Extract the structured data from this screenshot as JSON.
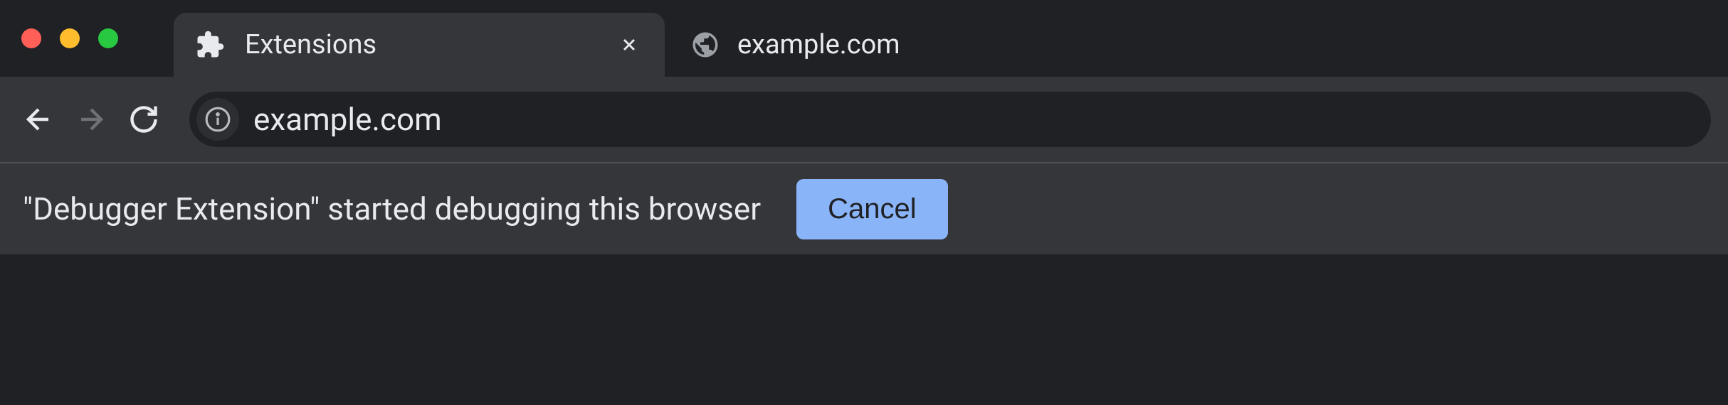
{
  "tabs": [
    {
      "title": "Extensions",
      "icon": "puzzle-icon",
      "active": true
    },
    {
      "title": "example.com",
      "icon": "globe-icon",
      "active": false
    }
  ],
  "toolbar": {
    "url": "example.com"
  },
  "notification": {
    "message": "\"Debugger Extension\" started debugging this browser",
    "cancel_label": "Cancel"
  }
}
